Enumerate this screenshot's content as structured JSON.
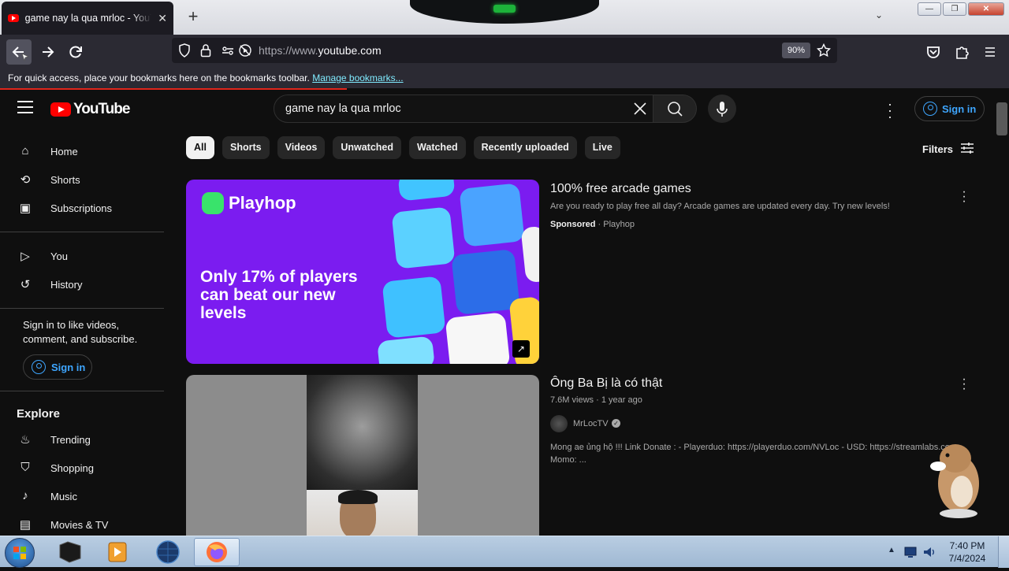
{
  "browser": {
    "tab_title": "game nay la qua mrloc - YouTube",
    "tab_close": "✕",
    "new_tab": "+",
    "tab_list": "⌄",
    "url_prefix": "https://www.",
    "url_domain": "youtube.com",
    "zoom": "90%",
    "bookmarks_msg": "For quick access, place your bookmarks here on the bookmarks toolbar.",
    "manage_bookmarks": "Manage bookmarks...",
    "window_min": "—",
    "window_max": "❐",
    "window_close": "✕"
  },
  "youtube": {
    "logo_text": "YouTube",
    "search_query": "game nay la qua mrloc",
    "signin_label": "Sign in",
    "sidebar": {
      "primary": [
        {
          "label": "Home",
          "icon": "home-icon",
          "glyph": "⌂"
        },
        {
          "label": "Shorts",
          "icon": "shorts-icon",
          "glyph": "⟲"
        },
        {
          "label": "Subscriptions",
          "icon": "subscriptions-icon",
          "glyph": "▣"
        }
      ],
      "secondary": [
        {
          "label": "You",
          "icon": "you-icon",
          "glyph": "▷"
        },
        {
          "label": "History",
          "icon": "history-icon",
          "glyph": "↺"
        }
      ],
      "signin_prompt": "Sign in to like videos, comment, and subscribe.",
      "signin_label": "Sign in",
      "explore_heading": "Explore",
      "explore": [
        {
          "label": "Trending",
          "icon": "trending-icon",
          "glyph": "♨"
        },
        {
          "label": "Shopping",
          "icon": "shopping-icon",
          "glyph": "⛉"
        },
        {
          "label": "Music",
          "icon": "music-icon",
          "glyph": "♪"
        },
        {
          "label": "Movies & TV",
          "icon": "movies-icon",
          "glyph": "▤"
        }
      ]
    },
    "chips": [
      "All",
      "Shorts",
      "Videos",
      "Unwatched",
      "Watched",
      "Recently uploaded",
      "Live"
    ],
    "filters_label": "Filters",
    "results": {
      "ad": {
        "thumb_brand": "Playhop",
        "thumb_headline": "Only 17% of players can beat our new levels",
        "title": "100% free arcade games",
        "description": "Are you ready to play free all day? Arcade games are updated every day. Try new levels!",
        "sponsored": "Sponsored",
        "advertiser": "Playhop"
      },
      "video": {
        "title": "Ông Ba Bị là có thật",
        "views": "7.6M views",
        "age": "1 year ago",
        "channel": "MrLocTV",
        "description_line1": "Mong ae ủng hộ !!! Link Donate : - Playerduo: https://playerduo.com/NVLoc - USD: https://streamlabs.com",
        "description_line2": "Momo: ..."
      }
    }
  },
  "taskbar": {
    "time": "7:40 PM",
    "date": "7/4/2024"
  },
  "colors": {
    "yt_bg": "#0f0f0f",
    "yt_red": "#ff0000",
    "link_blue": "#3ea6ff",
    "ad_purple": "#7b1cf0"
  }
}
